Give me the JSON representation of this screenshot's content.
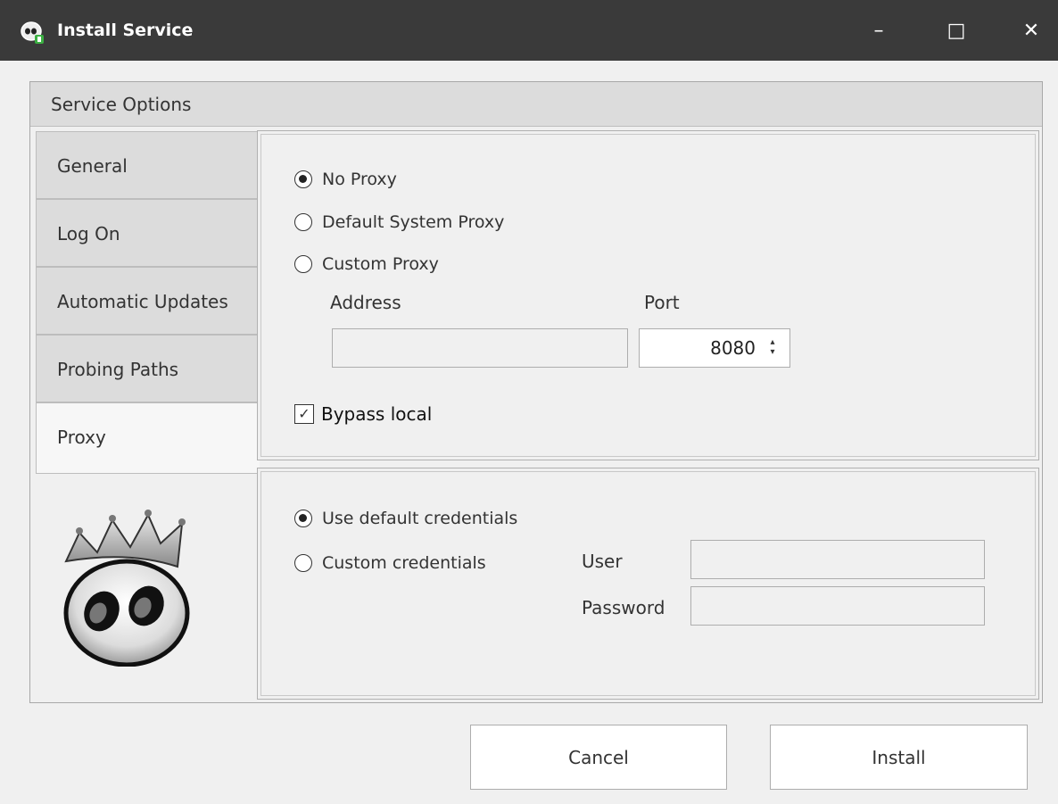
{
  "window": {
    "title": "Install Service",
    "icon": "app-mascot-icon",
    "minimize_glyph": "–",
    "maximize_glyph": "□",
    "close_glyph": "✕"
  },
  "group": {
    "header": "Service Options"
  },
  "tabs": [
    {
      "label": "General",
      "active": false
    },
    {
      "label": "Log On",
      "active": false
    },
    {
      "label": "Automatic Updates",
      "active": false
    },
    {
      "label": "Probing Paths",
      "active": false
    },
    {
      "label": "Proxy",
      "active": true
    }
  ],
  "proxy": {
    "options": [
      {
        "label": "No Proxy",
        "checked": true
      },
      {
        "label": "Default System Proxy",
        "checked": false
      },
      {
        "label": "Custom Proxy",
        "checked": false
      }
    ],
    "address_label": "Address",
    "address_value": "",
    "port_label": "Port",
    "port_value": "8080",
    "spin_up": "▴",
    "spin_down": "▾",
    "bypass_local_label": "Bypass local",
    "bypass_local_checked": true,
    "check_glyph": "✓"
  },
  "credentials": {
    "options": [
      {
        "label": "Use default credentials",
        "checked": true
      },
      {
        "label": "Custom credentials",
        "checked": false
      }
    ],
    "user_label": "User",
    "user_value": "",
    "password_label": "Password",
    "password_value": ""
  },
  "buttons": {
    "cancel": "Cancel",
    "install": "Install"
  }
}
